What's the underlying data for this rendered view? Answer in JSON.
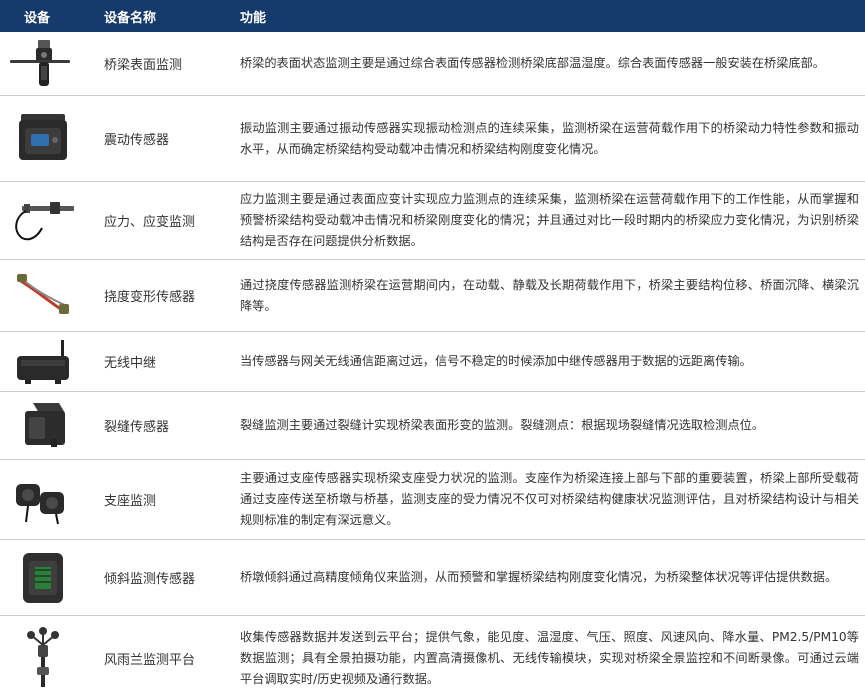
{
  "header": {
    "col_device": "设备",
    "col_name": "设备名称",
    "col_function": "功能"
  },
  "rows": [
    {
      "icon": "surface-sensor-icon",
      "name": "桥梁表面监测",
      "desc": "桥梁的表面状态监测主要是通过综合表面传感器检测桥梁底部温湿度。综合表面传感器一般安装在桥梁底部。"
    },
    {
      "icon": "vibration-sensor-icon",
      "name": "震动传感器",
      "desc": "振动监测主要通过振动传感器实现振动检测点的连续采集，监测桥梁在运营荷载作用下的桥梁动力特性参数和振动水平，从而确定桥梁结构受动载冲击情况和桥梁结构刚度变化情况。"
    },
    {
      "icon": "strain-gauge-icon",
      "name": "应力、应变监测",
      "desc": "应力监测主要是通过表面应变计实现应力监测点的连续采集，监测桥梁在运营荷载作用下的工作性能，从而掌握和预警桥梁结构受动载冲击情况和桥梁刚度变化的情况；并且通过对比一段时期内的桥梁应力变化情况，为识别桥梁结构是否存在问题提供分析数据。"
    },
    {
      "icon": "deflection-sensor-icon",
      "name": "挠度变形传感器",
      "desc": "通过挠度传感器监测桥梁在运营期间内，在动载、静载及长期荷载作用下，桥梁主要结构位移、桥面沉降、横梁沉降等。"
    },
    {
      "icon": "wireless-relay-icon",
      "name": "无线中继",
      "desc": "当传感器与网关无线通信距离过远，信号不稳定的时候添加中继传感器用于数据的远距离传输。"
    },
    {
      "icon": "crack-sensor-icon",
      "name": "裂缝传感器",
      "desc": "裂缝监测主要通过裂缝计实现桥梁表面形变的监测。裂缝测点：根据现场裂缝情况选取检测点位。"
    },
    {
      "icon": "bearing-sensor-icon",
      "name": "支座监测",
      "desc": "主要通过支座传感器实现桥梁支座受力状况的监测。支座作为桥梁连接上部与下部的重要装置，桥梁上部所受载荷通过支座传送至桥墩与桥基，监测支座的受力情况不仅可对桥梁结构健康状况监测评估，且对桥梁结构设计与相关规则标准的制定有深远意义。"
    },
    {
      "icon": "tilt-sensor-icon",
      "name": "倾斜监测传感器",
      "desc": "桥墩倾斜通过高精度倾角仪来监测，从而预警和掌握桥梁结构刚度变化情况，为桥梁整体状况等评估提供数据。"
    },
    {
      "icon": "weather-station-icon",
      "name": "风雨兰监测平台",
      "desc": "收集传感器数据并发送到云平台；提供气象，能见度、温湿度、气压、照度、风速风向、降水量、PM2.5/PM10等数据监测；具有全景拍摄功能，内置高清摄像机、无线传输模块，实现对桥梁全景监控和不间断录像。可通过云端平台调取实时/历史视频及通行数据。"
    }
  ]
}
